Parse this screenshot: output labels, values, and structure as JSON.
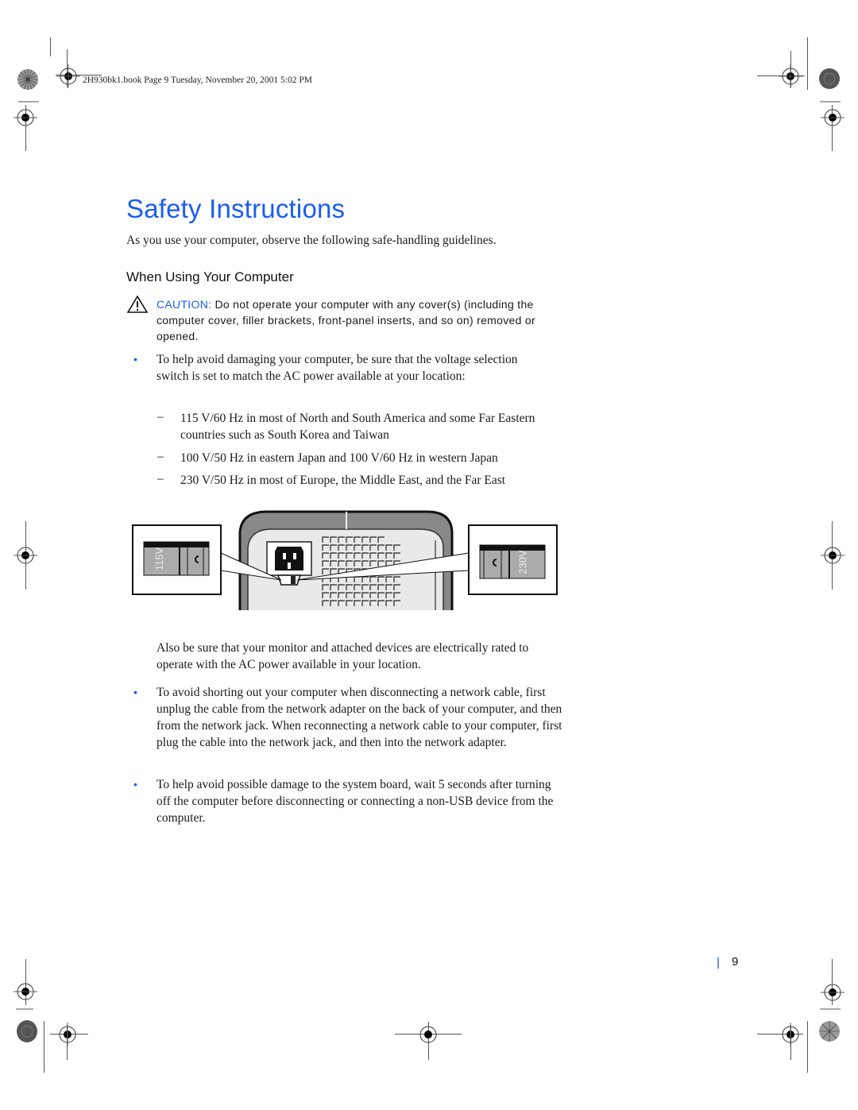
{
  "print_header": {
    "meta": "2H930bk1.book  Page 9  Tuesday, November 20, 2001  5:02 PM"
  },
  "page": {
    "title": "Safety Instructions",
    "intro": "As you use your computer, observe the following safe-handling guidelines.",
    "section_heading": "When Using Your Computer",
    "caution": {
      "icon": "warning-triangle-icon",
      "label": "CAUTION:",
      "text": " Do not operate your computer with any cover(s) (including the computer cover, filler brackets, front-panel inserts, and so on) removed or opened."
    },
    "bullets": [
      {
        "text": "To help avoid damaging your computer, be sure that the voltage selection switch is set to match the AC power available at your location:",
        "sub_items": [
          "115 V/60 Hz in most of North and South America and some Far Eastern countries such as South Korea and Taiwan",
          "100 V/50 Hz in eastern Japan and 100 V/60 Hz in western Japan",
          "230 V/50 Hz in most of Europe, the Middle East, and the Far East"
        ],
        "follow_up": "Also be sure that your monitor and attached devices are electrically rated to operate with the AC power available in your location."
      },
      {
        "text": "To avoid shorting out your computer when disconnecting a network cable, first unplug the cable from the network adapter on the back of your computer, and then from the network jack. When reconnecting a network cable to your computer, first plug the cable into the network jack, and then into the network adapter."
      },
      {
        "text": "To help avoid possible damage to the system board, wait 5 seconds after turning off the computer before disconnecting or connecting a non-USB device from the computer."
      }
    ],
    "bullet_glyph": "•",
    "dash_glyph": "–",
    "figure": {
      "left_switch_label": "115V",
      "right_switch_label": "230V"
    },
    "footer": {
      "page_number": "9"
    }
  },
  "colors": {
    "accent_blue": "#1a5cf5"
  }
}
